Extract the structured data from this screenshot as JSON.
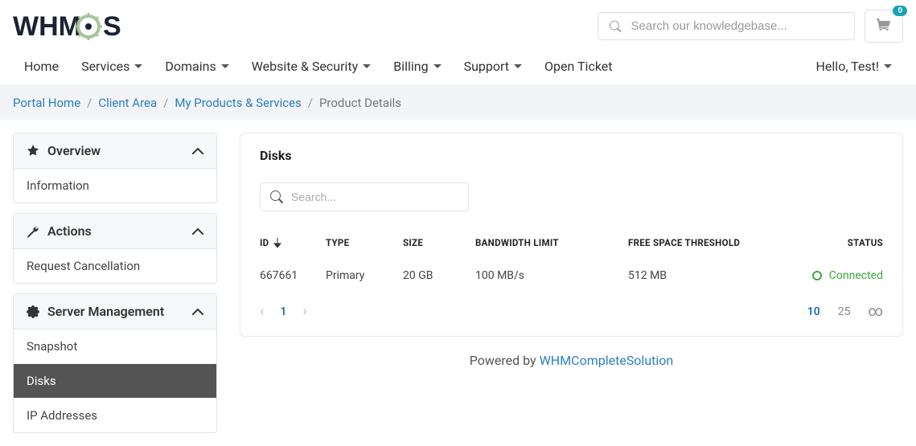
{
  "header": {
    "logo_text": "WHMCS",
    "search_placeholder": "Search our knowledgebase...",
    "cart_count": "0"
  },
  "nav": {
    "items": [
      {
        "label": "Home",
        "dropdown": false
      },
      {
        "label": "Services",
        "dropdown": true
      },
      {
        "label": "Domains",
        "dropdown": true
      },
      {
        "label": "Website & Security",
        "dropdown": true
      },
      {
        "label": "Billing",
        "dropdown": true
      },
      {
        "label": "Support",
        "dropdown": true
      },
      {
        "label": "Open Ticket",
        "dropdown": false
      }
    ],
    "user_greeting": "Hello, Test!"
  },
  "breadcrumb": [
    {
      "label": "Portal Home",
      "link": true
    },
    {
      "label": "Client Area",
      "link": true
    },
    {
      "label": "My Products & Services",
      "link": true
    },
    {
      "label": "Product Details",
      "link": false
    }
  ],
  "sidebar": {
    "overview": {
      "title": "Overview",
      "items": [
        "Information"
      ]
    },
    "actions": {
      "title": "Actions",
      "items": [
        "Request Cancellation"
      ]
    },
    "server": {
      "title": "Server Management",
      "items": [
        "Snapshot",
        "Disks",
        "IP Addresses"
      ],
      "active": "Disks"
    }
  },
  "card": {
    "title": "Disks",
    "search_placeholder": "Search...",
    "columns": {
      "id": "ID",
      "type": "TYPE",
      "size": "SIZE",
      "bw": "BANDWIDTH LIMIT",
      "free": "FREE SPACE THRESHOLD",
      "status": "STATUS"
    },
    "row": {
      "id": "667661",
      "type": "Primary",
      "size": "20 GB",
      "bw": "100 MB/s",
      "free": "512 MB",
      "status": "Connected"
    },
    "pagination": {
      "current": "1",
      "sizes": [
        "10",
        "25",
        "∞"
      ],
      "active_size": "10"
    }
  },
  "footer": {
    "text": "Powered by ",
    "link_text": "WHMCompleteSolution"
  }
}
